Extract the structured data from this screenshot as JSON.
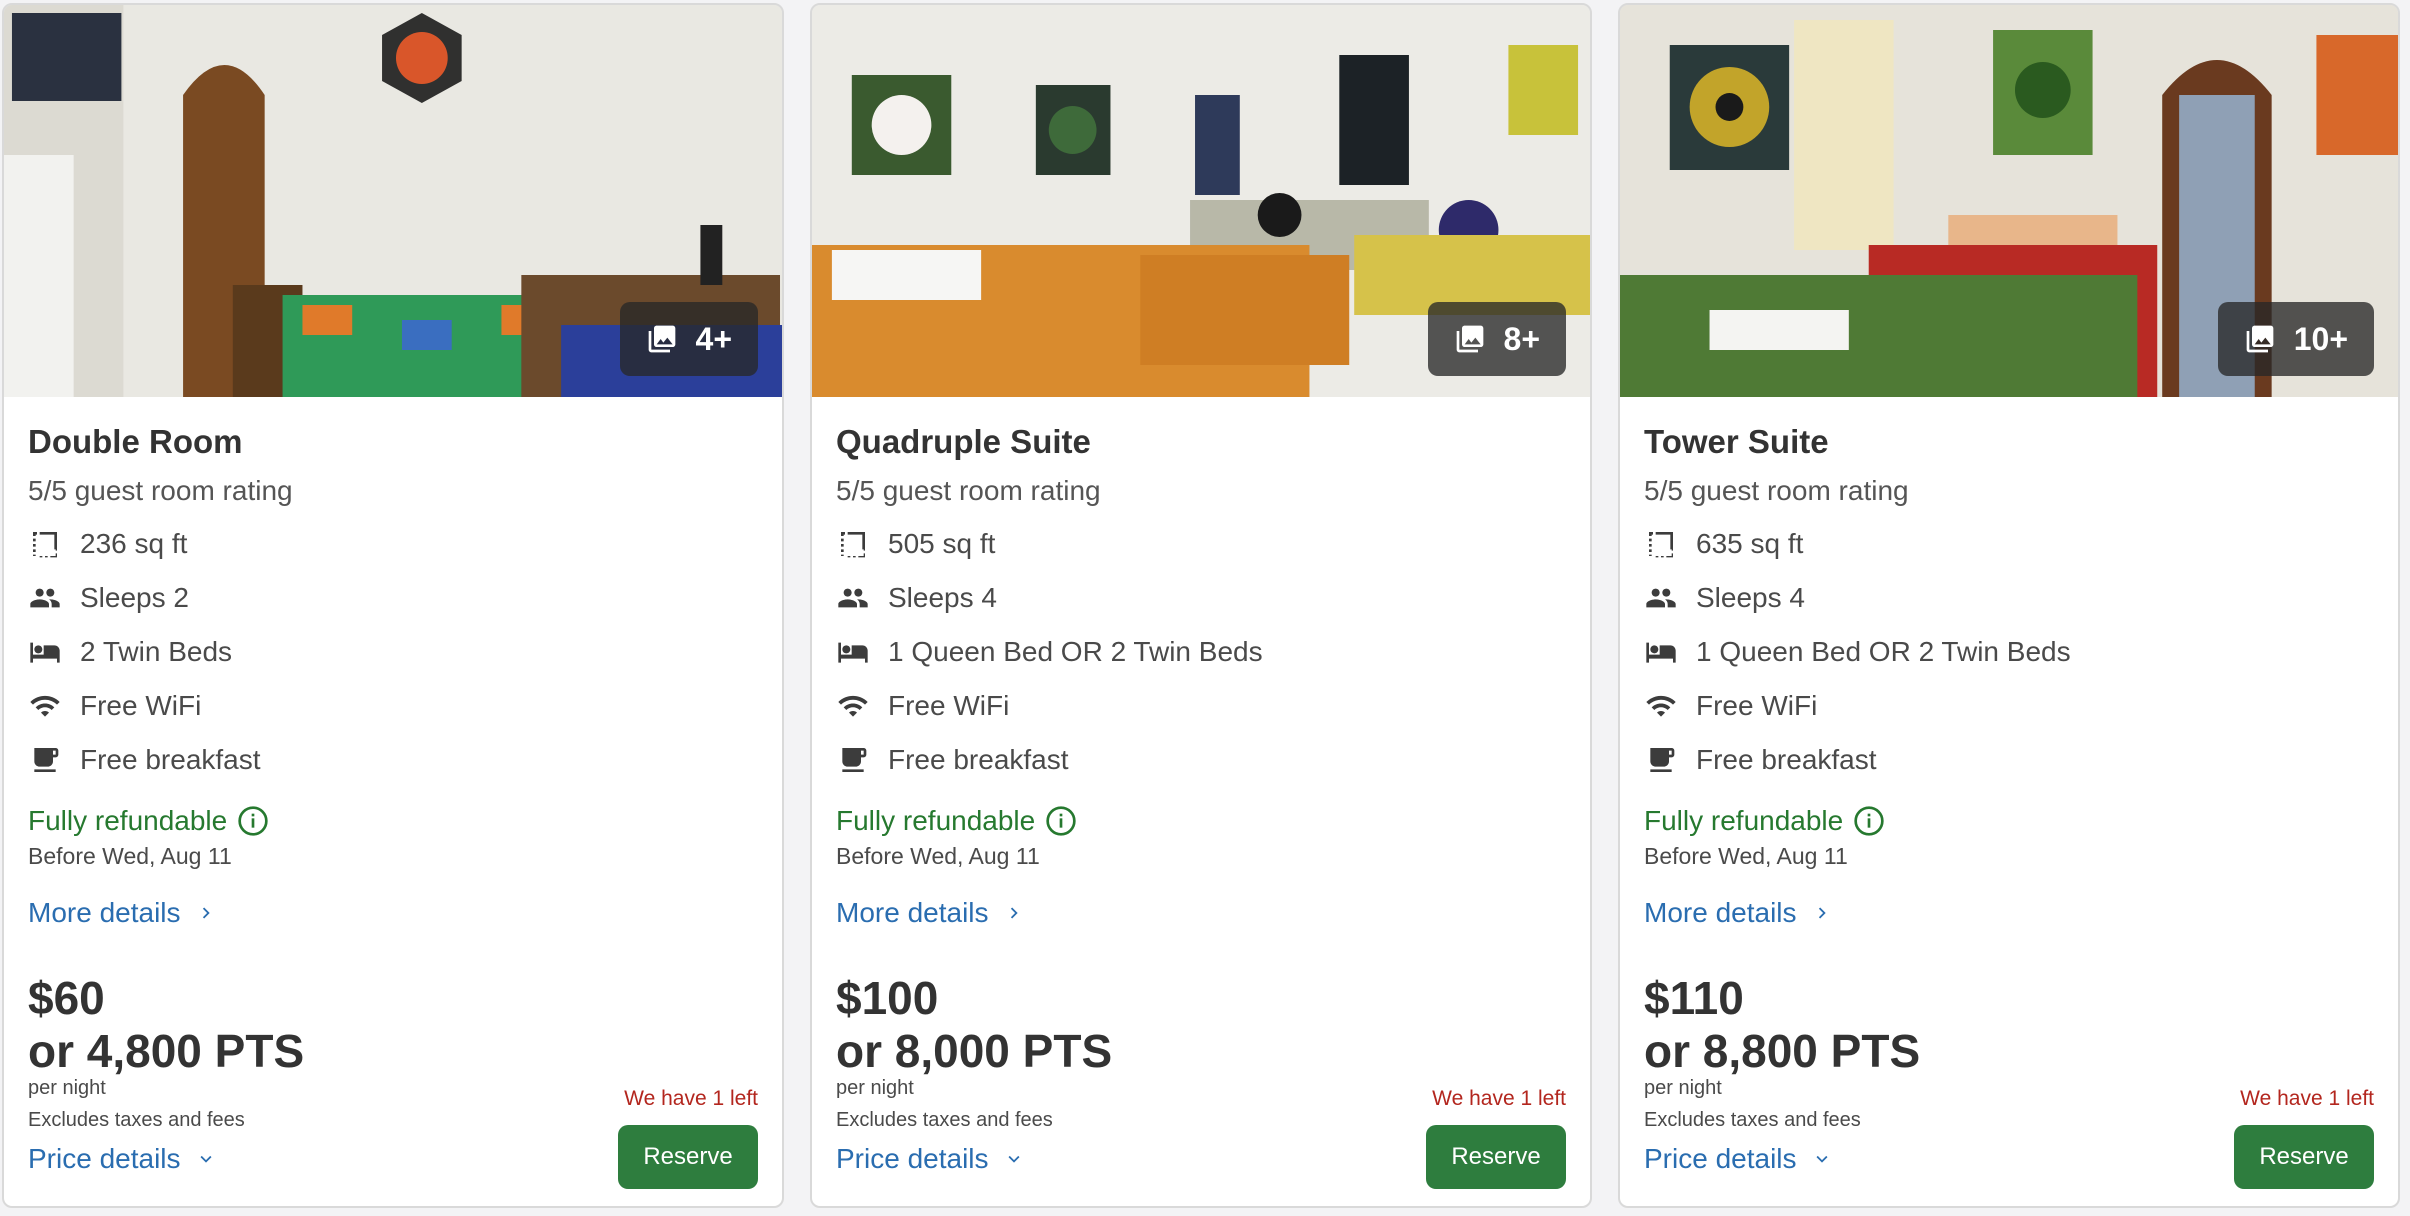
{
  "colors": {
    "refundable": "#26792f",
    "link": "#2a6db0",
    "scarcity": "#b3261e",
    "reserve_button": "#2e7d3e"
  },
  "rooms": [
    {
      "photo_count": "4+",
      "name": "Double Room",
      "rating": "5/5 guest room rating",
      "amenities": [
        {
          "icon": "floor-plan-icon",
          "text": "236 sq ft"
        },
        {
          "icon": "people-icon",
          "text": "Sleeps 2"
        },
        {
          "icon": "bed-icon",
          "text": "2 Twin Beds"
        },
        {
          "icon": "wifi-icon",
          "text": "Free WiFi"
        },
        {
          "icon": "coffee-icon",
          "text": "Free breakfast"
        }
      ],
      "refund": "Fully refundable",
      "refund_before": "Before Wed, Aug 11",
      "more_details": "More details",
      "price": "$60",
      "points": "or 4,800 PTS",
      "per_night": "per night",
      "excludes": "Excludes taxes and fees",
      "price_details": "Price details",
      "availability": "We have 1 left",
      "reserve": "Reserve"
    },
    {
      "photo_count": "8+",
      "name": "Quadruple Suite",
      "rating": "5/5 guest room rating",
      "amenities": [
        {
          "icon": "floor-plan-icon",
          "text": "505 sq ft"
        },
        {
          "icon": "people-icon",
          "text": "Sleeps 4"
        },
        {
          "icon": "bed-icon",
          "text": "1 Queen Bed OR 2 Twin Beds"
        },
        {
          "icon": "wifi-icon",
          "text": "Free WiFi"
        },
        {
          "icon": "coffee-icon",
          "text": "Free breakfast"
        }
      ],
      "refund": "Fully refundable",
      "refund_before": "Before Wed, Aug 11",
      "more_details": "More details",
      "price": "$100",
      "points": "or 8,000 PTS",
      "per_night": "per night",
      "excludes": "Excludes taxes and fees",
      "price_details": "Price details",
      "availability": "We have 1 left",
      "reserve": "Reserve"
    },
    {
      "photo_count": "10+",
      "name": "Tower Suite",
      "rating": "5/5 guest room rating",
      "amenities": [
        {
          "icon": "floor-plan-icon",
          "text": "635 sq ft"
        },
        {
          "icon": "people-icon",
          "text": "Sleeps 4"
        },
        {
          "icon": "bed-icon",
          "text": "1 Queen Bed OR 2 Twin Beds"
        },
        {
          "icon": "wifi-icon",
          "text": "Free WiFi"
        },
        {
          "icon": "coffee-icon",
          "text": "Free breakfast"
        }
      ],
      "refund": "Fully refundable",
      "refund_before": "Before Wed, Aug 11",
      "more_details": "More details",
      "price": "$110",
      "points": "or 8,800 PTS",
      "per_night": "per night",
      "excludes": "Excludes taxes and fees",
      "price_details": "Price details",
      "availability": "We have 1 left",
      "reserve": "Reserve"
    }
  ]
}
